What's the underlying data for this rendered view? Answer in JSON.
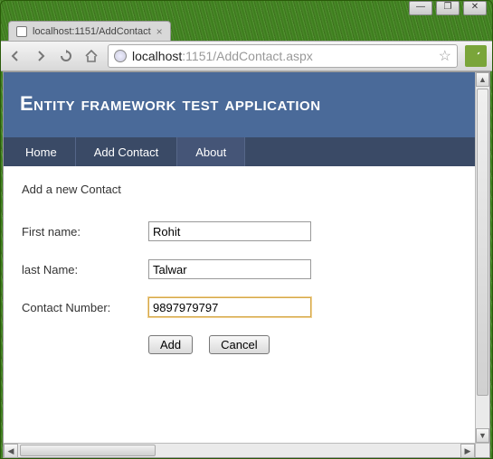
{
  "window": {
    "min_icon": "—",
    "max_icon": "❐",
    "close_icon": "✕"
  },
  "browser": {
    "tab_title": "localhost:1151/AddContact",
    "tab_close": "×",
    "url_host": "localhost",
    "url_rest": ":1151/AddContact.aspx"
  },
  "page": {
    "title": "Entity framework test application",
    "nav": {
      "home": "Home",
      "add": "Add Contact",
      "about": "About"
    },
    "subtitle": "Add a new Contact",
    "form": {
      "first_label": "First name:",
      "first_value": "Rohit",
      "last_label": "last Name:",
      "last_value": "Talwar",
      "contact_label": "Contact Number:",
      "contact_value": "9897979797"
    },
    "buttons": {
      "add": "Add",
      "cancel": "Cancel"
    }
  }
}
